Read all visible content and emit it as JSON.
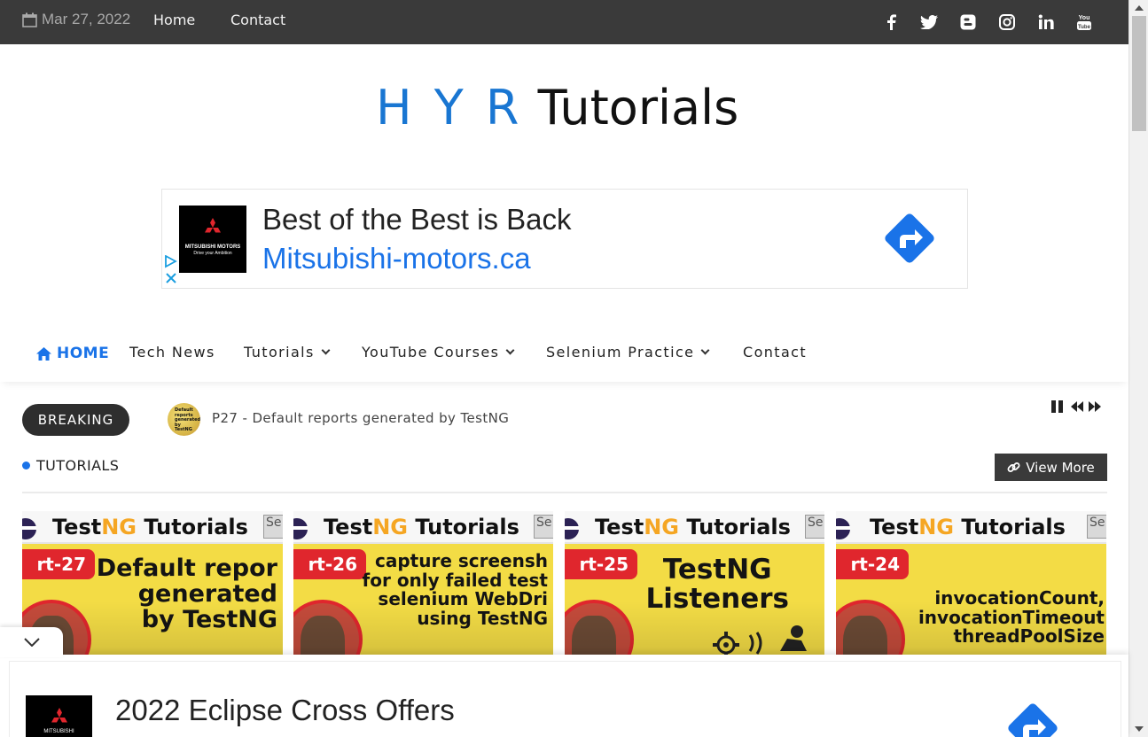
{
  "topbar": {
    "date": "Mar 27, 2022",
    "links": [
      "Home",
      "Contact"
    ],
    "social_icons": [
      "facebook-icon",
      "twitter-icon",
      "blogger-icon",
      "instagram-icon",
      "linkedin-icon",
      "youtube-icon"
    ]
  },
  "logo": {
    "part1": "H Y R",
    "part2": "Tutorials"
  },
  "ad": {
    "brand": "MITSUBISHI MOTORS",
    "tagline": "Drive your Ambition",
    "headline": "Best of the Best is Back",
    "url": "Mitsubishi-motors.ca"
  },
  "nav": {
    "home": "HOME",
    "tech_news": "Tech News",
    "tutorials": "Tutorials",
    "youtube_courses": "YouTube Courses",
    "selenium_practice": "Selenium Practice",
    "contact": "Contact"
  },
  "breaking": {
    "label": "BREAKING",
    "thumb_text": "Default reports generated by TestNG",
    "text": "P27 - Default reports generated by TestNG"
  },
  "section": {
    "title": "TUTORIALS",
    "view_more": "View More"
  },
  "cards": [
    {
      "title_a": "Test",
      "title_b": "NG",
      "title_c": " Tutorials",
      "se": "Se",
      "part": "rt-27",
      "caption": "Default repor\ngenerated\nby TestNG"
    },
    {
      "title_a": "Test",
      "title_b": "NG",
      "title_c": " Tutorials",
      "se": "Se",
      "part": "rt-26",
      "caption": "capture screensh\nfor only failed test\nselenium WebDri\nusing TestNG"
    },
    {
      "title_a": "Test",
      "title_b": "NG",
      "title_c": " Tutorials",
      "se": "Se",
      "part": "rt-25",
      "caption": "TestNG\nListeners"
    },
    {
      "title_a": "Test",
      "title_b": "NG",
      "title_c": " Tutorials",
      "se": "Se",
      "part": "rt-24",
      "caption": "invocationCount,\ninvocationTimeout\nthreadPoolSize"
    }
  ],
  "sticky_ad": {
    "headline": "2022 Eclipse Cross Offers",
    "brand": "MITSUBISHI"
  },
  "colors": {
    "topbar_bg": "#3a3a3a",
    "accent_blue": "#1a73e8",
    "thumbnail_yellow": "#f3dc45",
    "part_red": "#e0262d"
  }
}
